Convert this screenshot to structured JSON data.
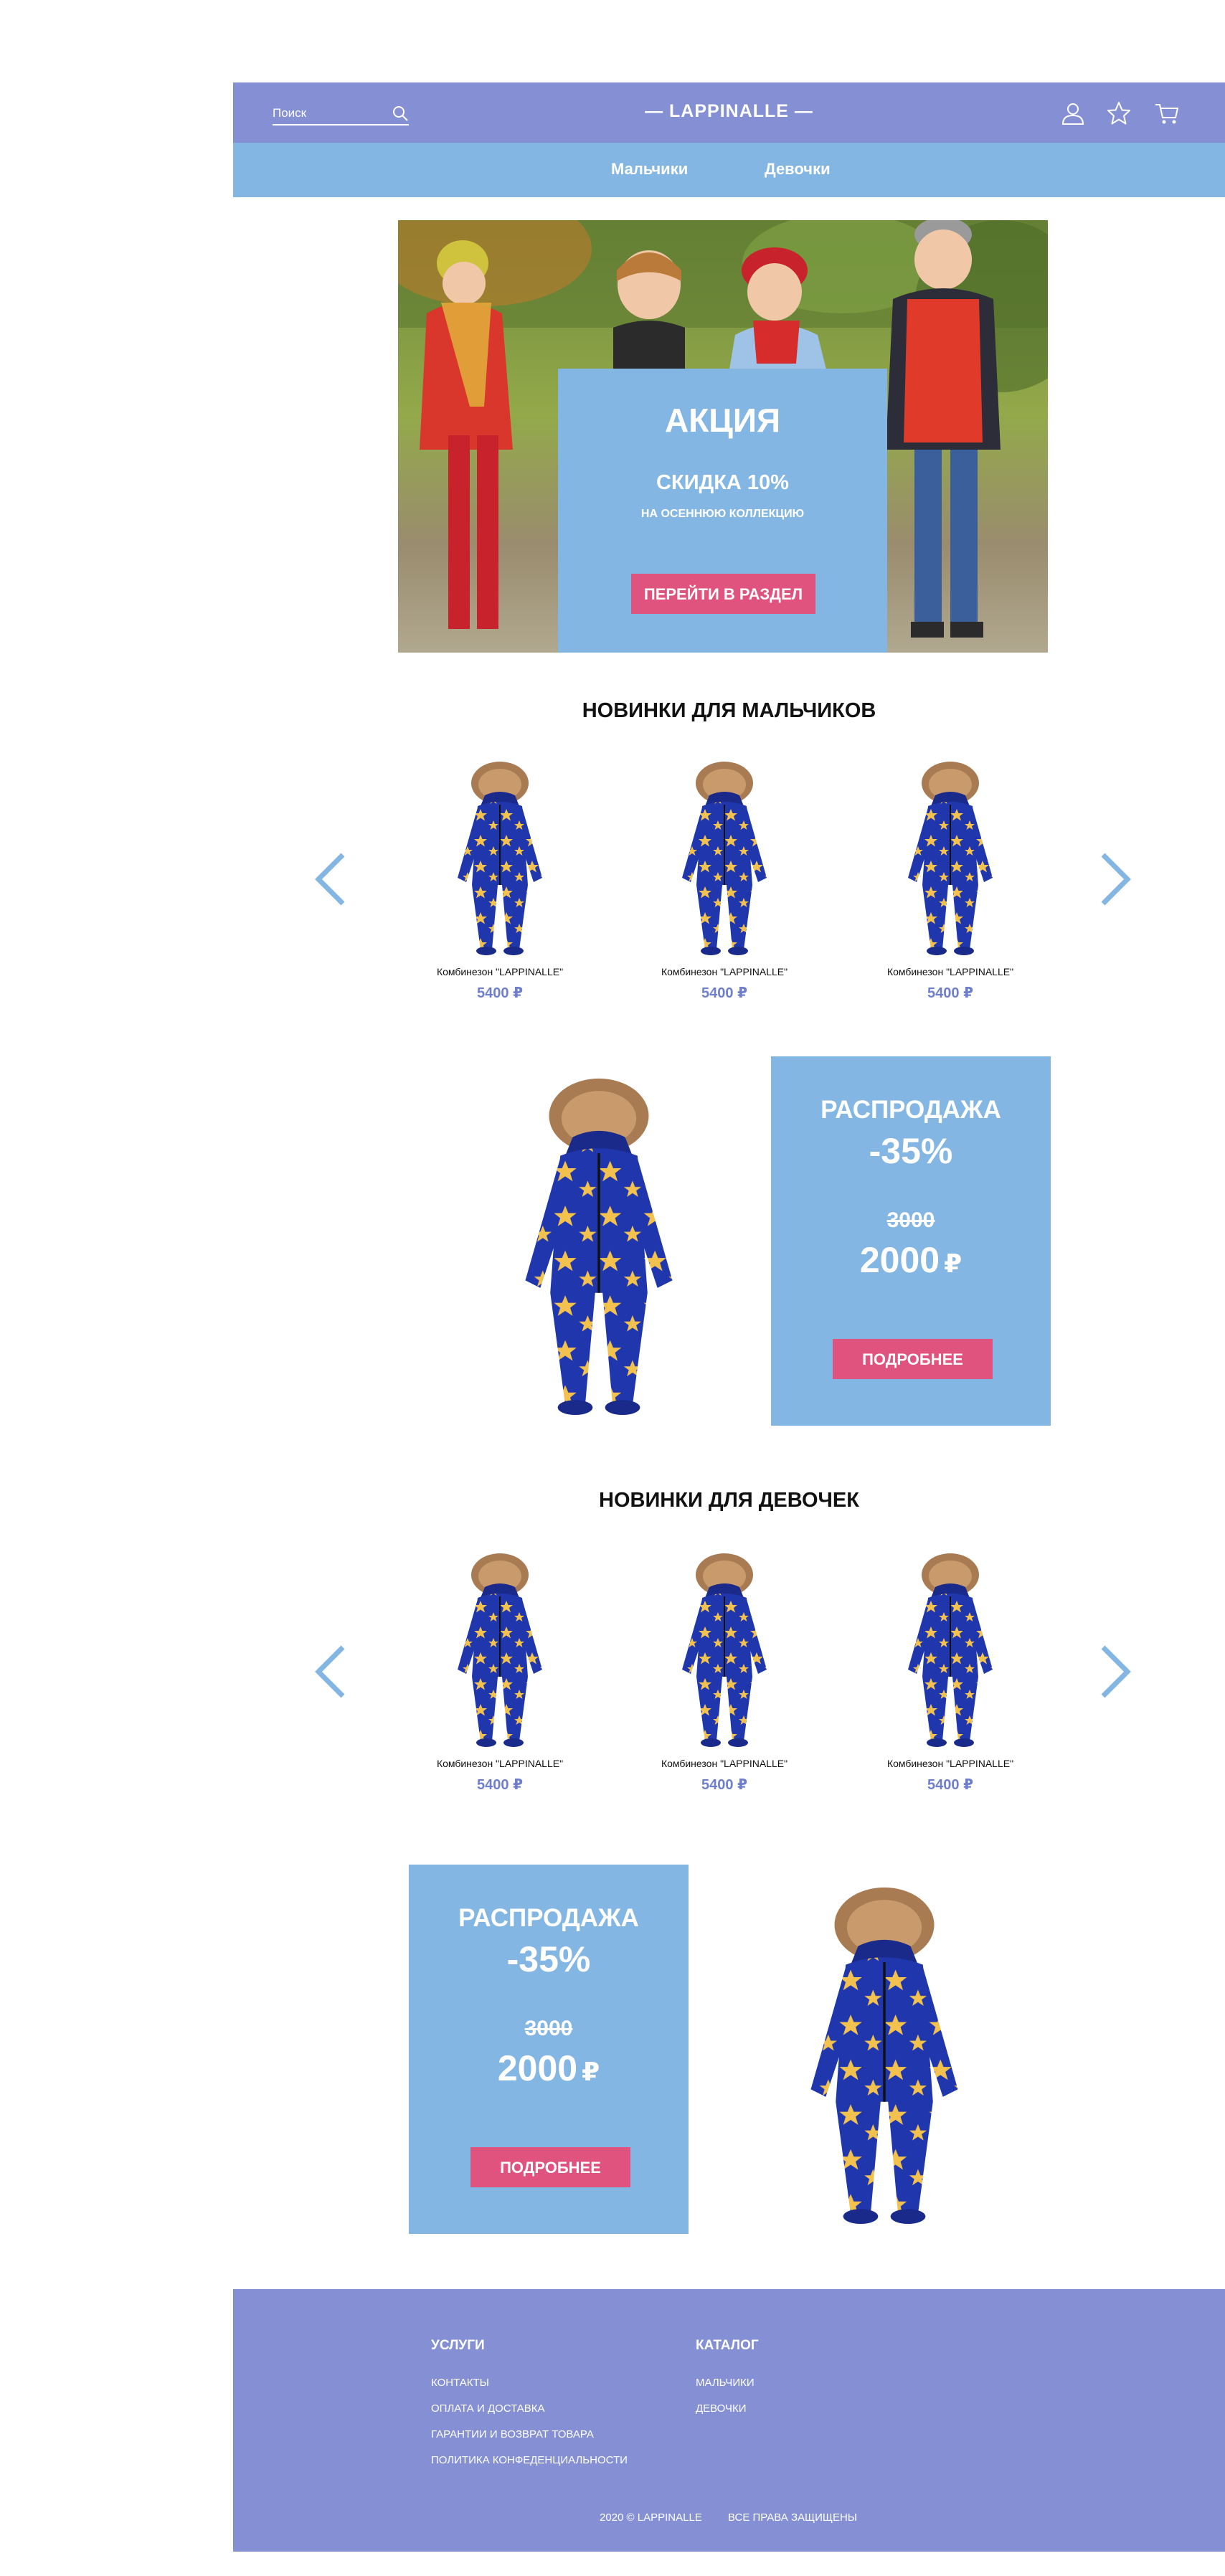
{
  "header": {
    "search_placeholder": "Поиск",
    "logo": "— LAPPINALLE —",
    "icons": [
      "user-icon",
      "star-icon",
      "cart-icon"
    ]
  },
  "nav": {
    "items": [
      "Мальчики",
      "Девочки"
    ]
  },
  "hero": {
    "title": "АКЦИЯ",
    "subtitle": "СКИДКА 10%",
    "small": "НА ОСЕННЮЮ КОЛЛЕКЦИЮ",
    "button": "ПЕРЕЙТИ В РАЗДЕЛ"
  },
  "boys": {
    "title": "НОВИНКИ ДЛЯ МАЛЬЧИКОВ",
    "products": [
      {
        "name": "Комбинезон \"LAPPINALLE\"",
        "price": "5400 ₽"
      },
      {
        "name": "Комбинезон \"LAPPINALLE\"",
        "price": "5400 ₽"
      },
      {
        "name": "Комбинезон \"LAPPINALLE\"",
        "price": "5400 ₽"
      }
    ]
  },
  "sale1": {
    "title": "РАСПРОДАЖА",
    "percent": "-35%",
    "old_price": "3000",
    "new_price": "2000",
    "currency": "₽",
    "button": "ПОДРОБНЕЕ"
  },
  "girls": {
    "title": "НОВИНКИ ДЛЯ ДЕВОЧЕК",
    "products": [
      {
        "name": "Комбинезон \"LAPPINALLE\"",
        "price": "5400 ₽"
      },
      {
        "name": "Комбинезон \"LAPPINALLE\"",
        "price": "5400 ₽"
      },
      {
        "name": "Комбинезон \"LAPPINALLE\"",
        "price": "5400 ₽"
      }
    ]
  },
  "sale2": {
    "title": "РАСПРОДАЖА",
    "percent": "-35%",
    "old_price": "3000",
    "new_price": "2000",
    "currency": "₽",
    "button": "ПОДРОБНЕЕ"
  },
  "footer": {
    "services_title": "УСЛУГИ",
    "services": [
      "КОНТАКТЫ",
      "ОПЛАТА И ДОСТАВКА",
      "ГАРАНТИИ И ВОЗВРАТ ТОВАРА",
      "ПОЛИТИКА КОНФЕДЕНЦИАЛЬНОСТИ"
    ],
    "catalog_title": "КАТАЛОГ",
    "catalog": [
      "МАЛЬЧИКИ",
      "ДЕВОЧКИ"
    ],
    "copyright": "2020 © LAPPINALLE",
    "rights": "ВСЕ ПРАВА ЗАЩИЩЕНЫ"
  },
  "colors": {
    "header": "#8490d3",
    "nav": "#83b6e2",
    "promo_box": "#83b6e2",
    "button": "#e0537e",
    "price": "#6f7fcc",
    "arrow": "#83b6e2",
    "suit": "#1f33a8",
    "star": "#f2c14e"
  }
}
